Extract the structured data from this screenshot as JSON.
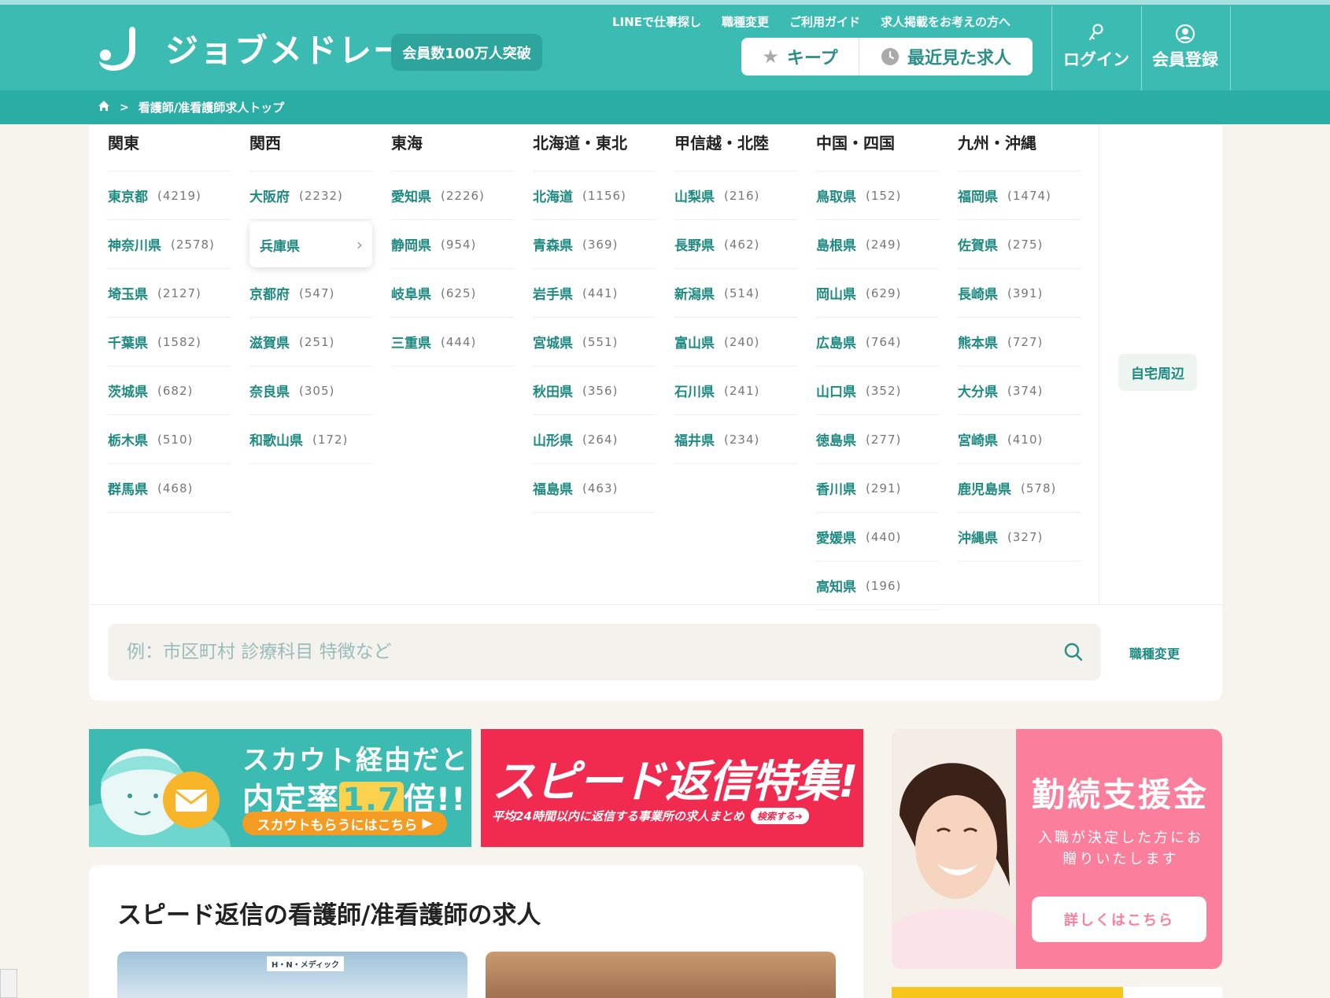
{
  "header": {
    "logo_text": "ジョブメドレー",
    "member_badge": "会員数100万人突破",
    "top_links": [
      "LINEで仕事探し",
      "職種変更",
      "ご利用ガイド",
      "求人掲載をお考えの方へ"
    ],
    "keep_label": "キープ",
    "recent_label": "最近見た求人",
    "login_label": "ログイン",
    "register_label": "会員登録"
  },
  "breadcrumb": {
    "current": "看護師/准看護師求人トップ"
  },
  "regions": [
    {
      "name": "関東",
      "prefs": [
        {
          "name": "東京都",
          "count": "(4219)"
        },
        {
          "name": "神奈川県",
          "count": "(2578)"
        },
        {
          "name": "埼玉県",
          "count": "(2127)"
        },
        {
          "name": "千葉県",
          "count": "(1582)"
        },
        {
          "name": "茨城県",
          "count": "(682)"
        },
        {
          "name": "栃木県",
          "count": "(510)"
        },
        {
          "name": "群馬県",
          "count": "(468)"
        }
      ]
    },
    {
      "name": "関西",
      "prefs": [
        {
          "name": "大阪府",
          "count": "(2232)"
        },
        {
          "name": "兵庫県",
          "count": ""
        },
        {
          "name": "京都府",
          "count": "(547)"
        },
        {
          "name": "滋賀県",
          "count": "(251)"
        },
        {
          "name": "奈良県",
          "count": "(305)"
        },
        {
          "name": "和歌山県",
          "count": "(172)"
        }
      ]
    },
    {
      "name": "東海",
      "prefs": [
        {
          "name": "愛知県",
          "count": "(2226)"
        },
        {
          "name": "静岡県",
          "count": "(954)"
        },
        {
          "name": "岐阜県",
          "count": "(625)"
        },
        {
          "name": "三重県",
          "count": "(444)"
        }
      ]
    },
    {
      "name": "北海道・東北",
      "prefs": [
        {
          "name": "北海道",
          "count": "(1156)"
        },
        {
          "name": "青森県",
          "count": "(369)"
        },
        {
          "name": "岩手県",
          "count": "(441)"
        },
        {
          "name": "宮城県",
          "count": "(551)"
        },
        {
          "name": "秋田県",
          "count": "(356)"
        },
        {
          "name": "山形県",
          "count": "(264)"
        },
        {
          "name": "福島県",
          "count": "(463)"
        }
      ]
    },
    {
      "name": "甲信越・北陸",
      "prefs": [
        {
          "name": "山梨県",
          "count": "(216)"
        },
        {
          "name": "長野県",
          "count": "(462)"
        },
        {
          "name": "新潟県",
          "count": "(514)"
        },
        {
          "name": "富山県",
          "count": "(240)"
        },
        {
          "name": "石川県",
          "count": "(241)"
        },
        {
          "name": "福井県",
          "count": "(234)"
        }
      ]
    },
    {
      "name": "中国・四国",
      "prefs": [
        {
          "name": "鳥取県",
          "count": "(152)"
        },
        {
          "name": "島根県",
          "count": "(249)"
        },
        {
          "name": "岡山県",
          "count": "(629)"
        },
        {
          "name": "広島県",
          "count": "(764)"
        },
        {
          "name": "山口県",
          "count": "(352)"
        },
        {
          "name": "徳島県",
          "count": "(277)"
        },
        {
          "name": "香川県",
          "count": "(291)"
        },
        {
          "name": "愛媛県",
          "count": "(440)"
        },
        {
          "name": "高知県",
          "count": "(196)"
        }
      ]
    },
    {
      "name": "九州・沖縄",
      "prefs": [
        {
          "name": "福岡県",
          "count": "(1474)"
        },
        {
          "name": "佐賀県",
          "count": "(275)"
        },
        {
          "name": "長崎県",
          "count": "(391)"
        },
        {
          "name": "熊本県",
          "count": "(727)"
        },
        {
          "name": "大分県",
          "count": "(374)"
        },
        {
          "name": "宮崎県",
          "count": "(410)"
        },
        {
          "name": "鹿児島県",
          "count": "(578)"
        },
        {
          "name": "沖縄県",
          "count": "(327)"
        }
      ]
    }
  ],
  "home_area_label": "自宅周辺",
  "search": {
    "placeholder": "例：市区町村 診療科目 特徴など",
    "job_change": "職種変更"
  },
  "banners": {
    "scout_line1": "スカウト経由だと",
    "scout_line2_pre": "内定率",
    "scout_rate": "1.7",
    "scout_line2_post": "倍!!",
    "scout_cta": "スカウトもらうにはこちら",
    "speed_title": "スピード返信特集!",
    "speed_sub": "平均24時間以内に返信する事業所の求人まとめ",
    "speed_search": "検索する➜",
    "retention_title": "勤続支援金",
    "retention_sub": "入職が決定した方にお贈りいたします",
    "retention_button": "詳しくはこちら"
  },
  "speed_section": {
    "title": "スピード返信の看護師/准看護師の求人",
    "card1_sign": "H・N・メディック"
  },
  "colors": {
    "brand": "#3bbbb2",
    "brand_dark": "#2aada4",
    "link": "#1f8a82",
    "pink": "#fb7f9c",
    "red": "#f02b4f"
  },
  "icons": [
    "logo-mark-icon",
    "star-icon",
    "clock-icon",
    "key-icon",
    "user-circle-icon",
    "home-icon",
    "chevron-right-icon",
    "search-icon",
    "mail-icon"
  ]
}
